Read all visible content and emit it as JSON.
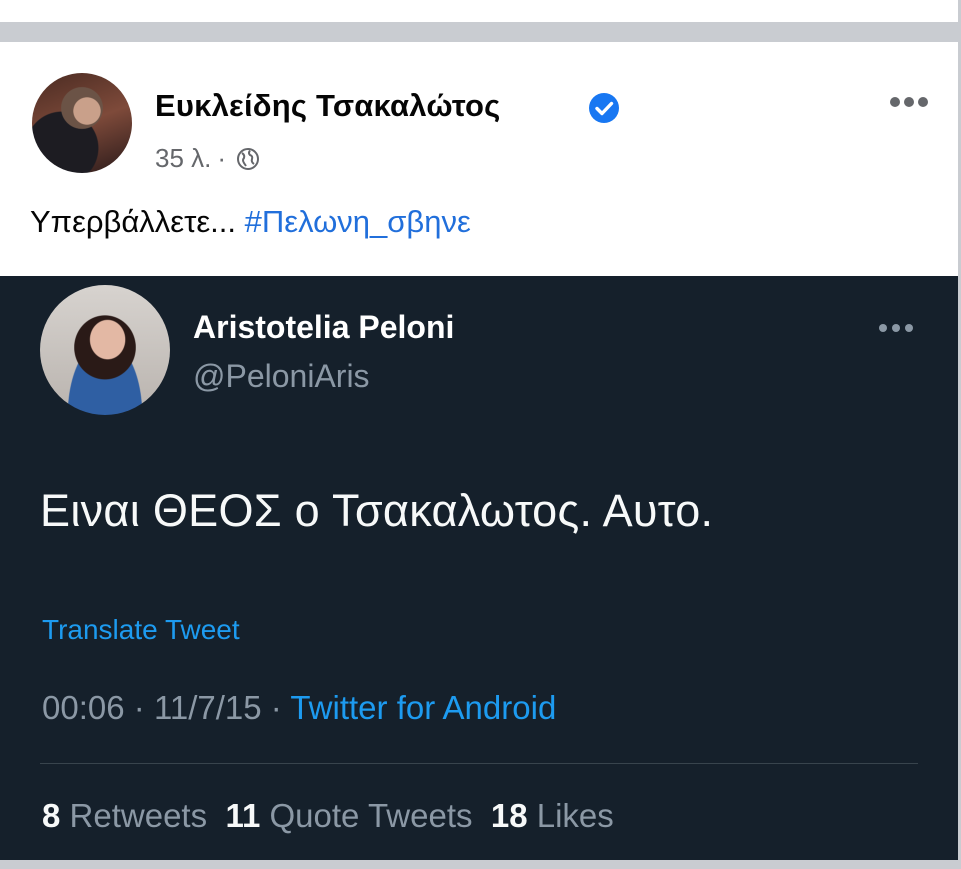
{
  "facebook_post": {
    "author": "Ευκλείδης Τσακαλώτος",
    "time": "35 λ.",
    "separator": "·",
    "text": "Υπερβάλλετε...",
    "hashtag": "#Πελωνη_σβηνε",
    "icons": {
      "verified": "verified-badge-icon",
      "audience": "globe-icon",
      "more": "more-options-icon"
    }
  },
  "tweet": {
    "name": "Aristotelia Peloni",
    "handle": "@PeloniAris",
    "text": "Ειναι ΘΕΟΣ ο Τσακαλωτος. Αυτο.",
    "translate": "Translate Tweet",
    "time": "00:06",
    "date": "11/7/15",
    "dot": "·",
    "source": "Twitter for Android",
    "stats": {
      "retweets_count": "8",
      "retweets_label": "Retweets",
      "quotes_count": "11",
      "quotes_label": "Quote Tweets",
      "likes_count": "18",
      "likes_label": "Likes"
    }
  },
  "colors": {
    "facebook_link": "#216fdb",
    "twitter_bg": "#15202b",
    "twitter_link": "#1d9bf0",
    "verified": "#1877f2"
  }
}
